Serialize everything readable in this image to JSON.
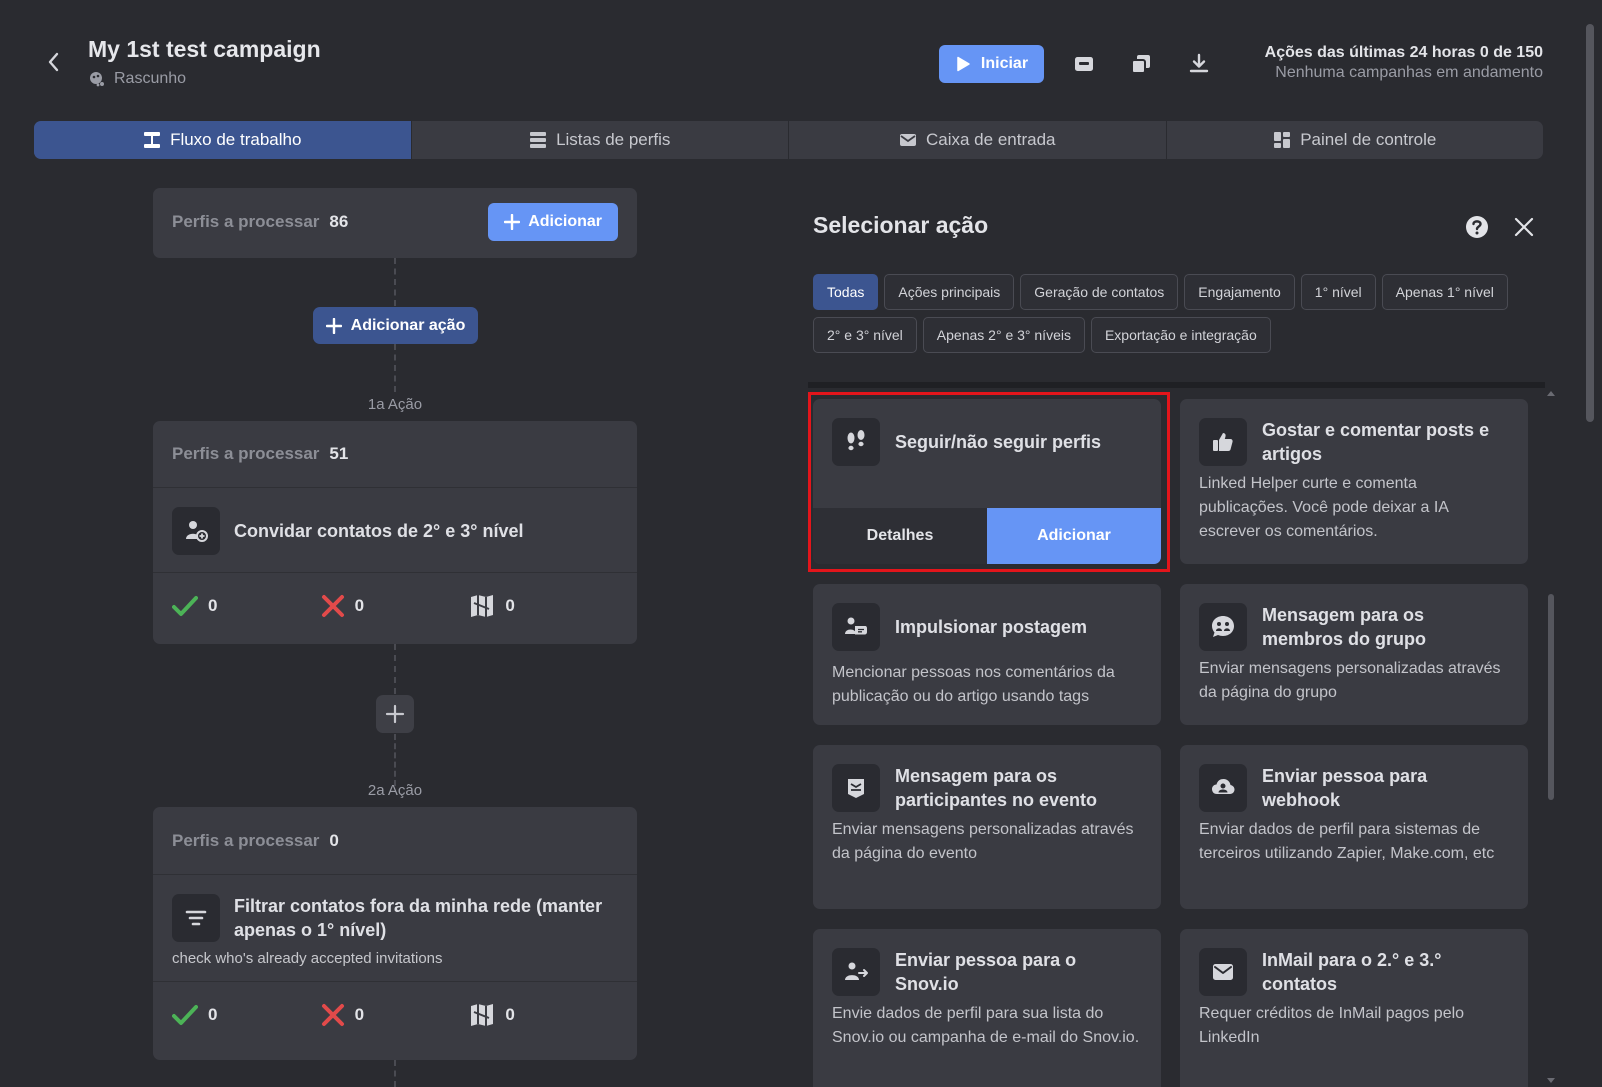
{
  "header": {
    "title": "My 1st test campaign",
    "status": "Rascunho",
    "start_label": "Iniciar",
    "stats_line1": "Ações das últimas 24 horas 0 de 150",
    "stats_line2": "Nenhuma campanhas em andamento"
  },
  "tabs": [
    {
      "label": "Fluxo de trabalho",
      "icon": "workflow-icon",
      "active": true
    },
    {
      "label": "Listas de perfis",
      "icon": "list-icon",
      "active": false
    },
    {
      "label": "Caixa de entrada",
      "icon": "envelope-icon",
      "active": false
    },
    {
      "label": "Painel de controle",
      "icon": "dashboard-icon",
      "active": false
    }
  ],
  "workflow": {
    "entry": {
      "label": "Perfis a processar",
      "count": "86",
      "add_label": "Adicionar"
    },
    "add_action_label": "Adicionar ação",
    "steps": [
      {
        "step_label": "1a Ação",
        "label": "Perfis a processar",
        "count": "51",
        "title": "Convidar contatos de 2° e 3° nível",
        "note": "",
        "success": "0",
        "failed": "0",
        "excluded": "0"
      },
      {
        "step_label": "2a Ação",
        "label": "Perfis a processar",
        "count": "0",
        "title": "Filtrar contatos fora da minha rede (manter apenas o 1° nível)",
        "note": "check who's already accepted invitations",
        "success": "0",
        "failed": "0",
        "excluded": "0"
      }
    ]
  },
  "panel": {
    "title": "Selecionar ação",
    "filters": [
      {
        "label": "Todas",
        "active": true
      },
      {
        "label": "Ações principais",
        "active": false
      },
      {
        "label": "Geração de contatos",
        "active": false
      },
      {
        "label": "Engajamento",
        "active": false
      },
      {
        "label": "1° nível",
        "active": false
      },
      {
        "label": "Apenas 1° nível",
        "active": false
      },
      {
        "label": "2° e 3° nível",
        "active": false
      },
      {
        "label": "Apenas 2° e 3° níveis",
        "active": false
      },
      {
        "label": "Exportação e integração",
        "active": false
      }
    ],
    "actions": [
      {
        "title": "Seguir/não seguir perfis",
        "desc": "",
        "icon": "footprints-icon",
        "details_label": "Detalhes",
        "add_label": "Adicionar"
      },
      {
        "title": "Gostar e comentar posts e artigos",
        "desc": "Linked Helper curte e comenta publicações. Você pode deixar a IA escrever os comentários.",
        "icon": "thumbs-up-icon"
      },
      {
        "title": "Impulsionar postagem",
        "desc": "Mencionar pessoas nos comentários da publicação ou do artigo usando tags",
        "icon": "boost-icon"
      },
      {
        "title": "Mensagem para os membros do grupo",
        "desc": "Enviar mensagens personalizadas através da página do grupo",
        "icon": "group-chat-icon"
      },
      {
        "title": "Mensagem para os participantes no evento",
        "desc": "Enviar mensagens personalizadas através da página do evento",
        "icon": "event-message-icon"
      },
      {
        "title": "Enviar pessoa para webhook",
        "desc": "Enviar dados de perfil para sistemas de terceiros utilizando Zapier, Make.com, etc",
        "icon": "webhook-icon"
      },
      {
        "title": "Enviar pessoa para o Snov.io",
        "desc": "Envie dados de perfil para sua lista do Snov.io ou campanha de e-mail do Snov.io.",
        "icon": "send-person-icon"
      },
      {
        "title": "InMail para o 2.° e 3.° contatos",
        "desc": "Requer créditos de InMail pagos pelo LinkedIn",
        "icon": "inmail-icon"
      }
    ]
  },
  "colors": {
    "background": "#2a2b30",
    "card": "#3a3b42",
    "accent": "#6695f5",
    "active_tab": "#3c5590",
    "success": "#4cb357",
    "failure": "#e24a4a",
    "highlight": "#e3151b"
  }
}
